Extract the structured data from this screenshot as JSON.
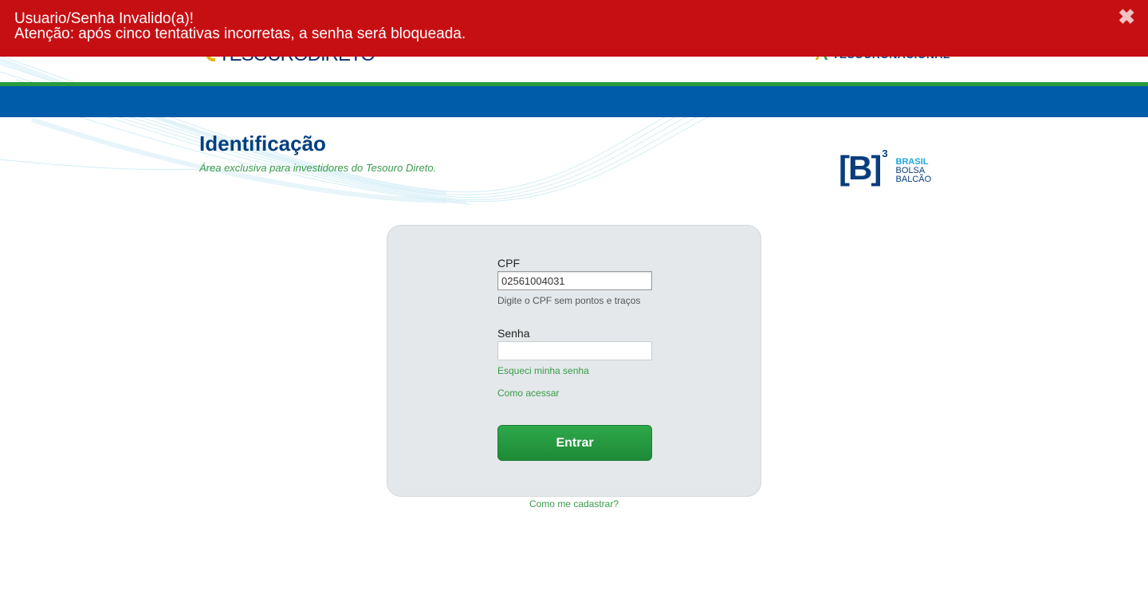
{
  "alert": {
    "line1": "Usuario/Senha Invalido(a)!",
    "line2": "Atenção: após cinco tentativas incorretas, a senha será bloqueada.",
    "close_glyph": "✖",
    "background": "#c60f13"
  },
  "header": {
    "logo_left": "TESOURODIRETO",
    "logo_right": "TESOURONACIONAL"
  },
  "page": {
    "title": "Identificação",
    "subtitle": "Área exclusiva para investidores do Tesouro Direto."
  },
  "b3_logo": {
    "mark": "[B]",
    "sup": "3",
    "word1": "BRASIL",
    "word2": "BOLSA",
    "word3": "BALCÃO"
  },
  "form": {
    "cpf_label": "CPF",
    "cpf_value": "02561004031",
    "cpf_hint": "Digite o CPF sem pontos e traços",
    "senha_label": "Senha",
    "senha_value": "",
    "forgot_link": "Esqueci minha senha",
    "how_access_link": "Como acessar",
    "submit_label": "Entrar"
  },
  "register_link": "Como me cadastrar?",
  "colors": {
    "primary_blue": "#005ca9",
    "green": "#2a9a3f",
    "title_blue": "#003f7f"
  }
}
